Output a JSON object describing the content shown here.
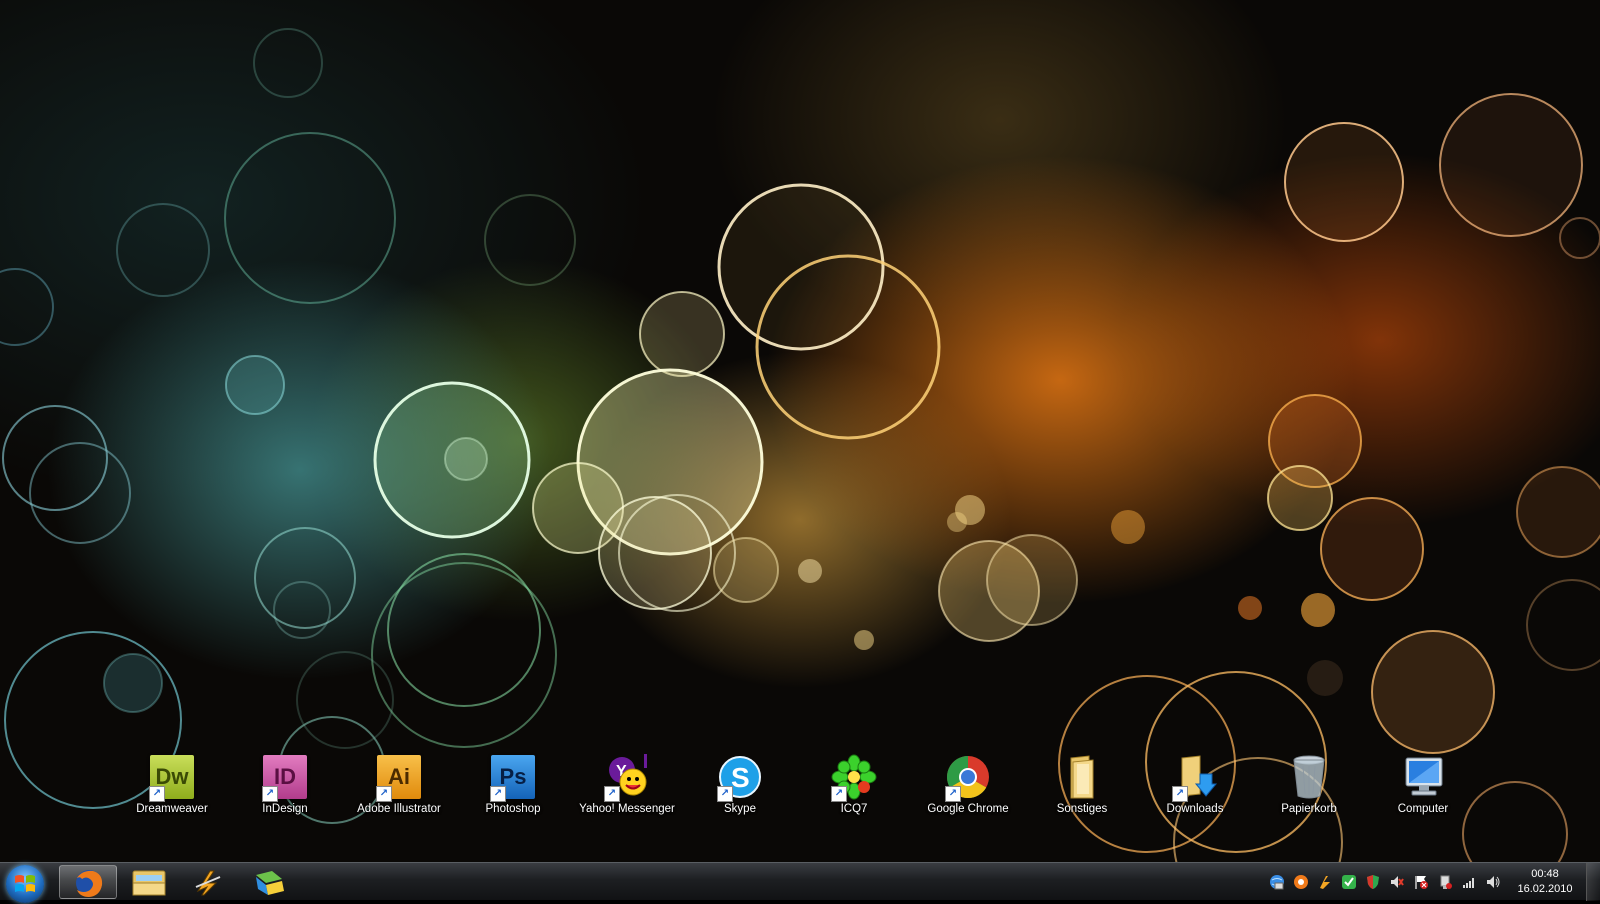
{
  "desktop_icons": [
    {
      "label": "Dreamweaver",
      "icon": "dreamweaver-icon"
    },
    {
      "label": "InDesign",
      "icon": "indesign-icon"
    },
    {
      "label": "Adobe Illustrator",
      "icon": "illustrator-icon"
    },
    {
      "label": "Photoshop",
      "icon": "photoshop-icon"
    },
    {
      "label": "Yahoo! Messenger",
      "icon": "yahoo-messenger-icon"
    },
    {
      "label": "Skype",
      "icon": "skype-icon"
    },
    {
      "label": "ICQ7",
      "icon": "icq-icon"
    },
    {
      "label": "Google Chrome",
      "icon": "chrome-icon"
    },
    {
      "label": "Sonstiges",
      "icon": "folder-icon"
    },
    {
      "label": "Downloads",
      "icon": "downloads-folder-icon"
    },
    {
      "label": "Papierkorb",
      "icon": "recycle-bin-icon"
    },
    {
      "label": "Computer",
      "icon": "computer-icon"
    }
  ],
  "adobe_glyphs": {
    "dw": "Dw",
    "id": "ID",
    "ai": "Ai",
    "ps": "Ps"
  },
  "taskbar": {
    "pinned": [
      "firefox-icon",
      "explorer-folder-icon",
      "winamp-icon",
      "windows-flag-icon"
    ],
    "tray": [
      "network-globe-icon",
      "avast-icon",
      "winamp-tray-icon",
      "checkmark-icon",
      "shield-icon",
      "volume-muted-icon",
      "flag-alert-icon",
      "usb-icon",
      "signal-icon",
      "speaker-icon"
    ],
    "clock": {
      "time": "00:48",
      "date": "16.02.2010"
    }
  },
  "colors": {
    "dreamweaver": "#b6cf3a",
    "indesign": "#d25aa8",
    "illustrator": "#f4a81c",
    "photoshop": "#1f7bd6",
    "taskbar": "#1d1f22"
  }
}
